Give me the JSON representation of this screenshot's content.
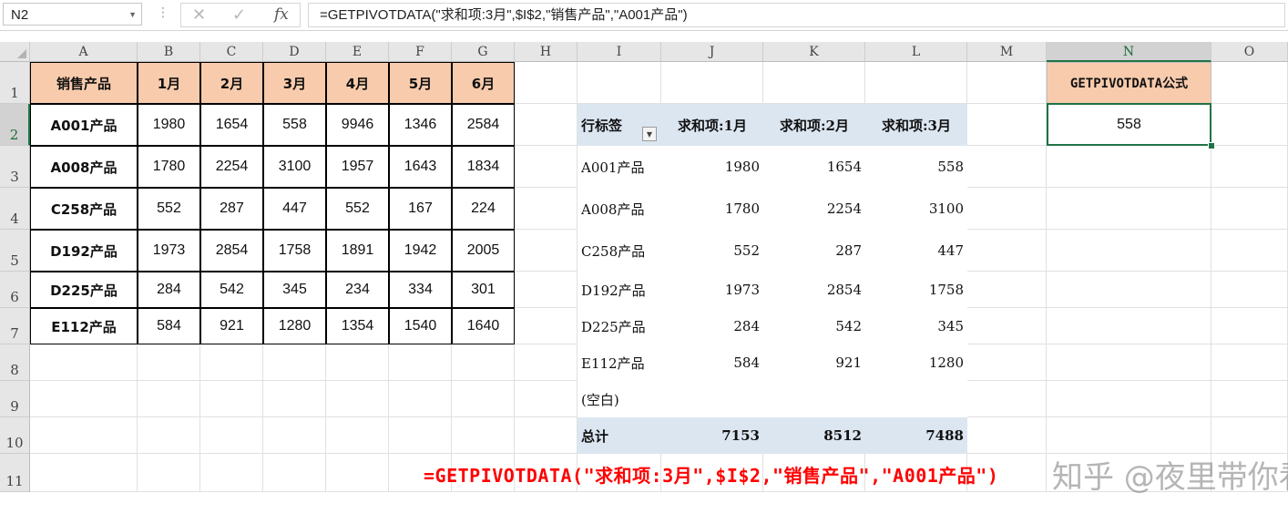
{
  "formula_bar": {
    "name_box": "N2",
    "formula": "=GETPIVOTDATA(\"求和项:3月\",$I$2,\"销售产品\",\"A001产品\")"
  },
  "columns": [
    "A",
    "B",
    "C",
    "D",
    "E",
    "F",
    "G",
    "H",
    "I",
    "J",
    "K",
    "L",
    "M",
    "N",
    "O"
  ],
  "rows": [
    "1",
    "2",
    "3",
    "4",
    "5",
    "6",
    "7",
    "8",
    "9",
    "10",
    "11"
  ],
  "source_table": {
    "headers": [
      "销售产品",
      "1月",
      "2月",
      "3月",
      "4月",
      "5月",
      "6月"
    ],
    "rows": [
      [
        "A001产品",
        "1980",
        "1654",
        "558",
        "9946",
        "1346",
        "2584"
      ],
      [
        "A008产品",
        "1780",
        "2254",
        "3100",
        "1957",
        "1643",
        "1834"
      ],
      [
        "C258产品",
        "552",
        "287",
        "447",
        "552",
        "167",
        "224"
      ],
      [
        "D192产品",
        "1973",
        "2854",
        "1758",
        "1891",
        "1942",
        "2005"
      ],
      [
        "D225产品",
        "284",
        "542",
        "345",
        "234",
        "334",
        "301"
      ],
      [
        "E112产品",
        "584",
        "921",
        "1280",
        "1354",
        "1540",
        "1640"
      ]
    ]
  },
  "pivot": {
    "headers": [
      "行标签",
      "求和项:1月",
      "求和项:2月",
      "求和项:3月"
    ],
    "rows": [
      [
        "A001产品",
        "1980",
        "1654",
        "558"
      ],
      [
        "A008产品",
        "1780",
        "2254",
        "3100"
      ],
      [
        "C258产品",
        "552",
        "287",
        "447"
      ],
      [
        "D192产品",
        "1973",
        "2854",
        "1758"
      ],
      [
        "D225产品",
        "284",
        "542",
        "345"
      ],
      [
        "E112产品",
        "584",
        "921",
        "1280"
      ],
      [
        "(空白)",
        "",
        "",
        ""
      ]
    ],
    "total": [
      "总计",
      "7153",
      "8512",
      "7488"
    ]
  },
  "result": {
    "header": "GETPIVOTDATA公式",
    "value": "558"
  },
  "annotation": "=GETPIVOTDATA(\"求和项:3月\",$I$2,\"销售产品\",\"A001产品\")",
  "watermark": "知乎 @夜里带你看海"
}
